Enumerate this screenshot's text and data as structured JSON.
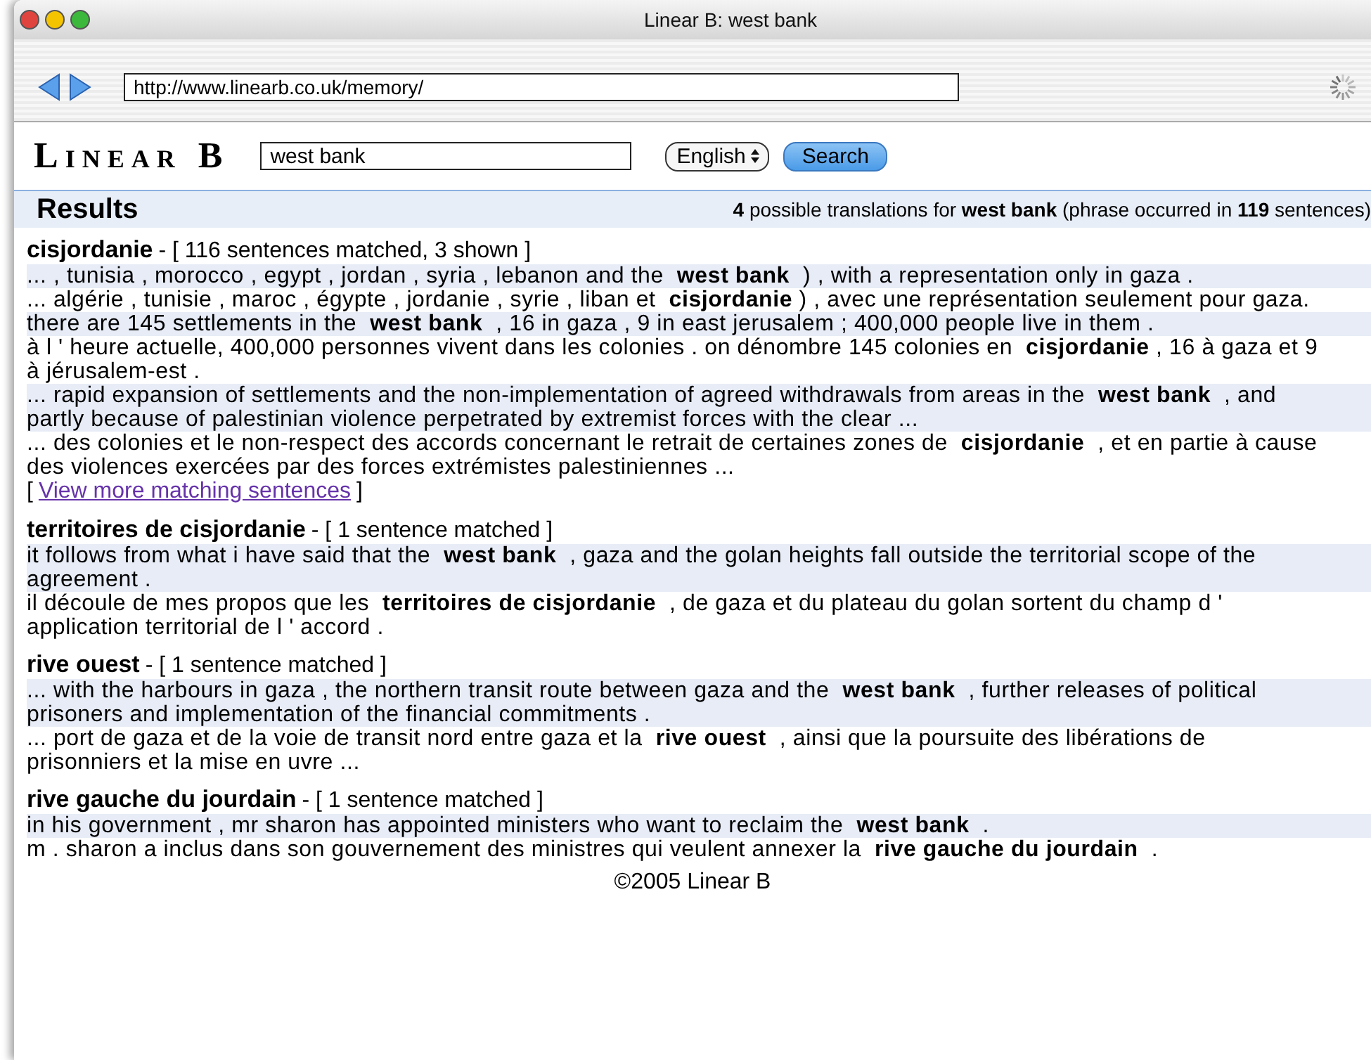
{
  "window": {
    "title": "Linear B: west bank"
  },
  "toolbar": {
    "url": "http://www.linearb.co.uk/memory/"
  },
  "header": {
    "logo": "Linear B",
    "search_value": "west bank",
    "language": "English",
    "button": "Search"
  },
  "results": {
    "title": "Results",
    "summary": "**4** possible translations for **west bank** (phrase occurred in **119** sentences)"
  },
  "entries": [
    {
      "term": "cisjordanie",
      "info": "- [ 116 sentences matched, 3 shown ]",
      "sentences": [
        {
          "kind": "source",
          "text": "... , tunisia , morocco , egypt , jordan , syria , lebanon and the  **west bank**  ) , with a representation only in gaza ."
        },
        {
          "kind": "target",
          "text": "... algérie , tunisie , maroc , égypte , jordanie , syrie , liban et  **cisjordanie** ) , avec une représentation seulement pour gaza."
        },
        {
          "kind": "source",
          "text": "there are 145 settlements in the  **west bank**  , 16 in gaza , 9 in east jerusalem ; 400,000 people live in them ."
        },
        {
          "kind": "target",
          "text": "à l ' heure actuelle, 400,000 personnes vivent dans les colonies . on dénombre 145 colonies en  **cisjordanie** , 16 à gaza et 9 à jérusalem-est ."
        },
        {
          "kind": "source",
          "text": "... rapid expansion of settlements and the non-implementation of agreed withdrawals from areas in the  **west bank**  , and partly because of palestinian violence perpetrated by extremist forces with the clear ..."
        },
        {
          "kind": "target",
          "text": "... des colonies et le non-respect des accords concernant le retrait de certaines zones de  **cisjordanie**  , et en partie à cause des violences exercées par des forces extrémistes palestiniennes ..."
        }
      ],
      "more": {
        "open": "[",
        "link": "View more matching sentences",
        "close": "]"
      }
    },
    {
      "term": "territoires de cisjordanie",
      "info": "- [ 1 sentence matched  ]",
      "sentences": [
        {
          "kind": "source",
          "text": "it follows from what i have said that the  **west bank**  , gaza and the golan heights fall outside the territorial scope of the agreement ."
        },
        {
          "kind": "target",
          "text": "il découle de mes propos que les  **territoires de cisjordanie**  , de gaza et du plateau du golan sortent du champ d ' application territorial de l ' accord ."
        }
      ]
    },
    {
      "term": "rive ouest",
      "info": "- [ 1 sentence matched  ]",
      "sentences": [
        {
          "kind": "source",
          "text": "... with the harbours in gaza , the northern transit route between gaza and the  **west bank**  , further releases of political prisoners and implementation of the financial commitments ."
        },
        {
          "kind": "target",
          "text": "... port de gaza et de la voie de transit nord entre gaza et la  **rive ouest**  , ainsi que la poursuite des libérations de prisonniers et la mise en uvre ..."
        }
      ]
    },
    {
      "term": "rive gauche du jourdain",
      "info": "- [ 1 sentence matched  ]",
      "sentences": [
        {
          "kind": "source",
          "text": "in his government , mr sharon has appointed ministers who want to reclaim the  **west bank**  ."
        },
        {
          "kind": "target",
          "text": "m . sharon a inclus dans son gouvernement des ministres qui veulent annexer la  **rive gauche du jourdain**  ."
        }
      ]
    }
  ],
  "footer": "©2005 Linear B"
}
